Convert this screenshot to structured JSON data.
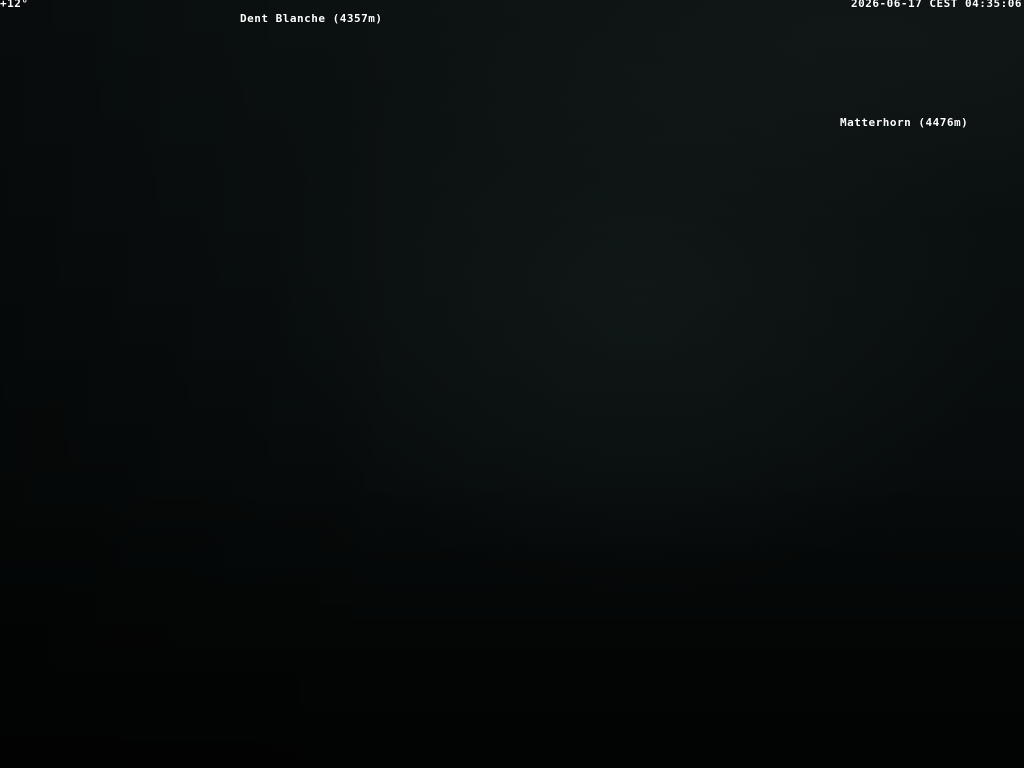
{
  "overlay": {
    "temperature": "+12°",
    "timestamp": "2026-06-17 CEST 04:35:06"
  },
  "peaks": [
    {
      "label": "Dent Blanche (4357m)"
    },
    {
      "label": "Matterhorn (4476m)"
    }
  ]
}
